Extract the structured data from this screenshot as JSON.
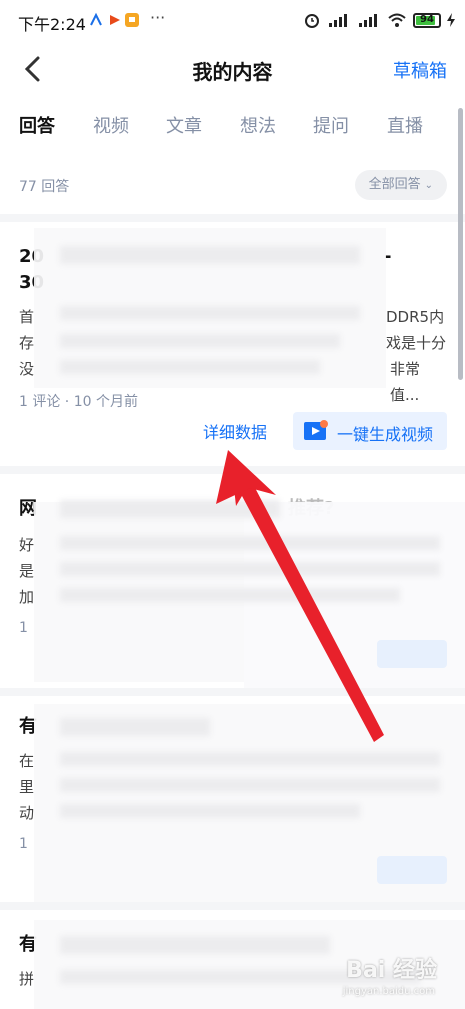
{
  "status_bar": {
    "time": "下午2:24",
    "battery": "94"
  },
  "nav": {
    "title": "我的内容",
    "drafts": "草稿箱"
  },
  "tabs": [
    "回答",
    "视频",
    "文章",
    "想法",
    "提问",
    "直播"
  ],
  "summary": {
    "count": "77 回答",
    "filter": "全部回答"
  },
  "cards": [
    {
      "title_line1": "20",
      "title_end1": "-",
      "title_line2": "30",
      "excerpt_line1_start": "首",
      "excerpt_line1_end": "DDR5内",
      "excerpt_line2_start": "存",
      "excerpt_line2_end": "戏是十分",
      "excerpt_line3_start": "没",
      "excerpt_line3_end": "非常值...",
      "meta": "1 评论 · 10 个月前",
      "detail_link": "详细数据",
      "generate_video": "一键生成视频"
    },
    {
      "title_start": "网",
      "title_end": "推荐?",
      "excerpt_line1_start": "好",
      "excerpt_line2_start": "是",
      "excerpt_line3_start": "加",
      "meta_start": "1"
    },
    {
      "title_start": "有",
      "excerpt_line1_start": "在",
      "excerpt_line2_start": "里",
      "excerpt_line3_start": "动",
      "meta_start": "1"
    },
    {
      "title_start": "有",
      "excerpt_line1_start": "拼"
    }
  ],
  "watermark": {
    "text": "Bai 经验",
    "sub": "jingyan.baidu.com"
  },
  "colors": {
    "accent": "#1772f6",
    "annotation_arrow": "#e8212b"
  }
}
